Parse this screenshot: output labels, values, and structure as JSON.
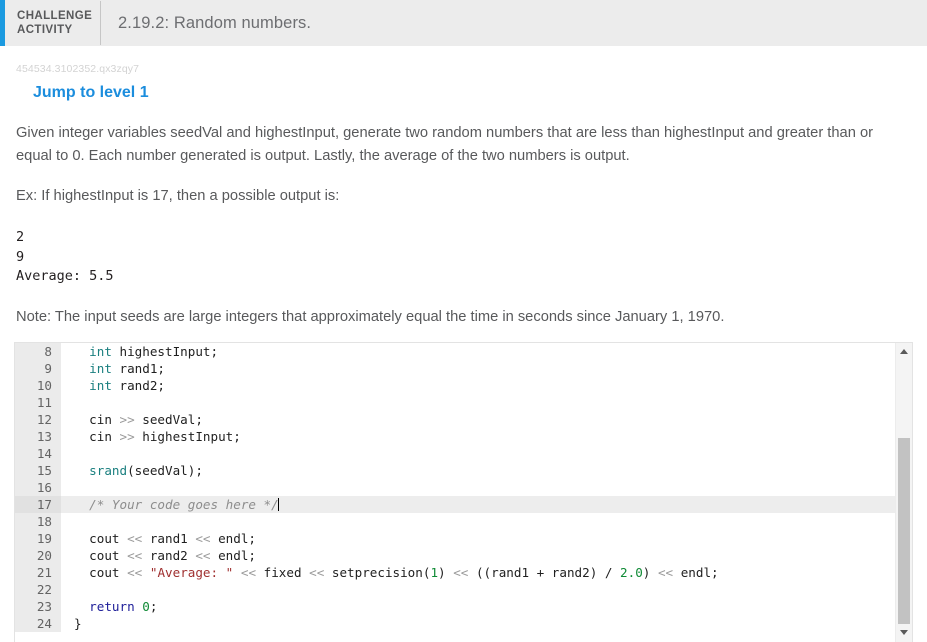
{
  "header": {
    "kicker_line1": "CHALLENGE",
    "kicker_line2": "ACTIVITY",
    "title": "2.19.2: Random numbers.",
    "accent_color": "#1b9ae0",
    "background_color": "#ececec"
  },
  "activity": {
    "id": "454534.3102352.qx3zqy7",
    "jump_link": "Jump to level 1",
    "jump_link_color": "#1b8ddd"
  },
  "prompt": {
    "paragraph1": "Given integer variables seedVal and highestInput, generate two random numbers that are less than highestInput and greater than or equal to 0. Each number generated is output. Lastly, the average of the two numbers is output.",
    "paragraph2": "Ex: If highestInput is 17, then a possible output is:",
    "sample_output": "2\n9\nAverage: 5.5",
    "note": "Note: The input seeds are large integers that approximately equal the time in seconds since January 1, 1970."
  },
  "editor": {
    "active_line": 17,
    "first_visible_line": 8,
    "last_visible_line": 24,
    "lines": [
      {
        "num": "8",
        "tokens": [
          {
            "t": "kw",
            "s": "int"
          },
          {
            "t": "pl",
            "s": " highestInput;"
          }
        ]
      },
      {
        "num": "9",
        "tokens": [
          {
            "t": "kw",
            "s": "int"
          },
          {
            "t": "pl",
            "s": " rand1;"
          }
        ]
      },
      {
        "num": "10",
        "tokens": [
          {
            "t": "kw",
            "s": "int"
          },
          {
            "t": "pl",
            "s": " rand2;"
          }
        ]
      },
      {
        "num": "11",
        "tokens": []
      },
      {
        "num": "12",
        "tokens": [
          {
            "t": "pl",
            "s": "cin "
          },
          {
            "t": "op",
            "s": ">>"
          },
          {
            "t": "pl",
            "s": " seedVal;"
          }
        ]
      },
      {
        "num": "13",
        "tokens": [
          {
            "t": "pl",
            "s": "cin "
          },
          {
            "t": "op",
            "s": ">>"
          },
          {
            "t": "pl",
            "s": " highestInput;"
          }
        ]
      },
      {
        "num": "14",
        "tokens": []
      },
      {
        "num": "15",
        "tokens": [
          {
            "t": "kw",
            "s": "srand"
          },
          {
            "t": "pl",
            "s": "(seedVal);"
          }
        ]
      },
      {
        "num": "16",
        "tokens": []
      },
      {
        "num": "17",
        "tokens": [
          {
            "t": "cmt",
            "s": "/* Your code goes here */"
          },
          {
            "t": "caret",
            "s": ""
          }
        ]
      },
      {
        "num": "18",
        "tokens": []
      },
      {
        "num": "19",
        "tokens": [
          {
            "t": "pl",
            "s": "cout "
          },
          {
            "t": "op",
            "s": "<<"
          },
          {
            "t": "pl",
            "s": " rand1 "
          },
          {
            "t": "op",
            "s": "<<"
          },
          {
            "t": "pl",
            "s": " endl;"
          }
        ]
      },
      {
        "num": "20",
        "tokens": [
          {
            "t": "pl",
            "s": "cout "
          },
          {
            "t": "op",
            "s": "<<"
          },
          {
            "t": "pl",
            "s": " rand2 "
          },
          {
            "t": "op",
            "s": "<<"
          },
          {
            "t": "pl",
            "s": " endl;"
          }
        ]
      },
      {
        "num": "21",
        "tokens": [
          {
            "t": "pl",
            "s": "cout "
          },
          {
            "t": "op",
            "s": "<<"
          },
          {
            "t": "pl",
            "s": " "
          },
          {
            "t": "str",
            "s": "\"Average: \""
          },
          {
            "t": "pl",
            "s": " "
          },
          {
            "t": "op",
            "s": "<<"
          },
          {
            "t": "pl",
            "s": " fixed "
          },
          {
            "t": "op",
            "s": "<<"
          },
          {
            "t": "pl",
            "s": " setprecision("
          },
          {
            "t": "num",
            "s": "1"
          },
          {
            "t": "pl",
            "s": ") "
          },
          {
            "t": "op",
            "s": "<<"
          },
          {
            "t": "pl",
            "s": " ((rand1 + rand2) / "
          },
          {
            "t": "num",
            "s": "2.0"
          },
          {
            "t": "pl",
            "s": ") "
          },
          {
            "t": "op",
            "s": "<<"
          },
          {
            "t": "pl",
            "s": " endl;"
          }
        ]
      },
      {
        "num": "22",
        "tokens": []
      },
      {
        "num": "23",
        "tokens": [
          {
            "t": "ctl",
            "s": "return"
          },
          {
            "t": "pl",
            "s": " "
          },
          {
            "t": "num",
            "s": "0"
          },
          {
            "t": "pl",
            "s": ";"
          }
        ]
      },
      {
        "num": "24",
        "tokens": [
          {
            "t": "pl",
            "s": "}"
          }
        ],
        "no_indent": true
      }
    ],
    "scrollbar": {
      "up_arrow": "scroll-up",
      "down_arrow": "scroll-down"
    }
  }
}
